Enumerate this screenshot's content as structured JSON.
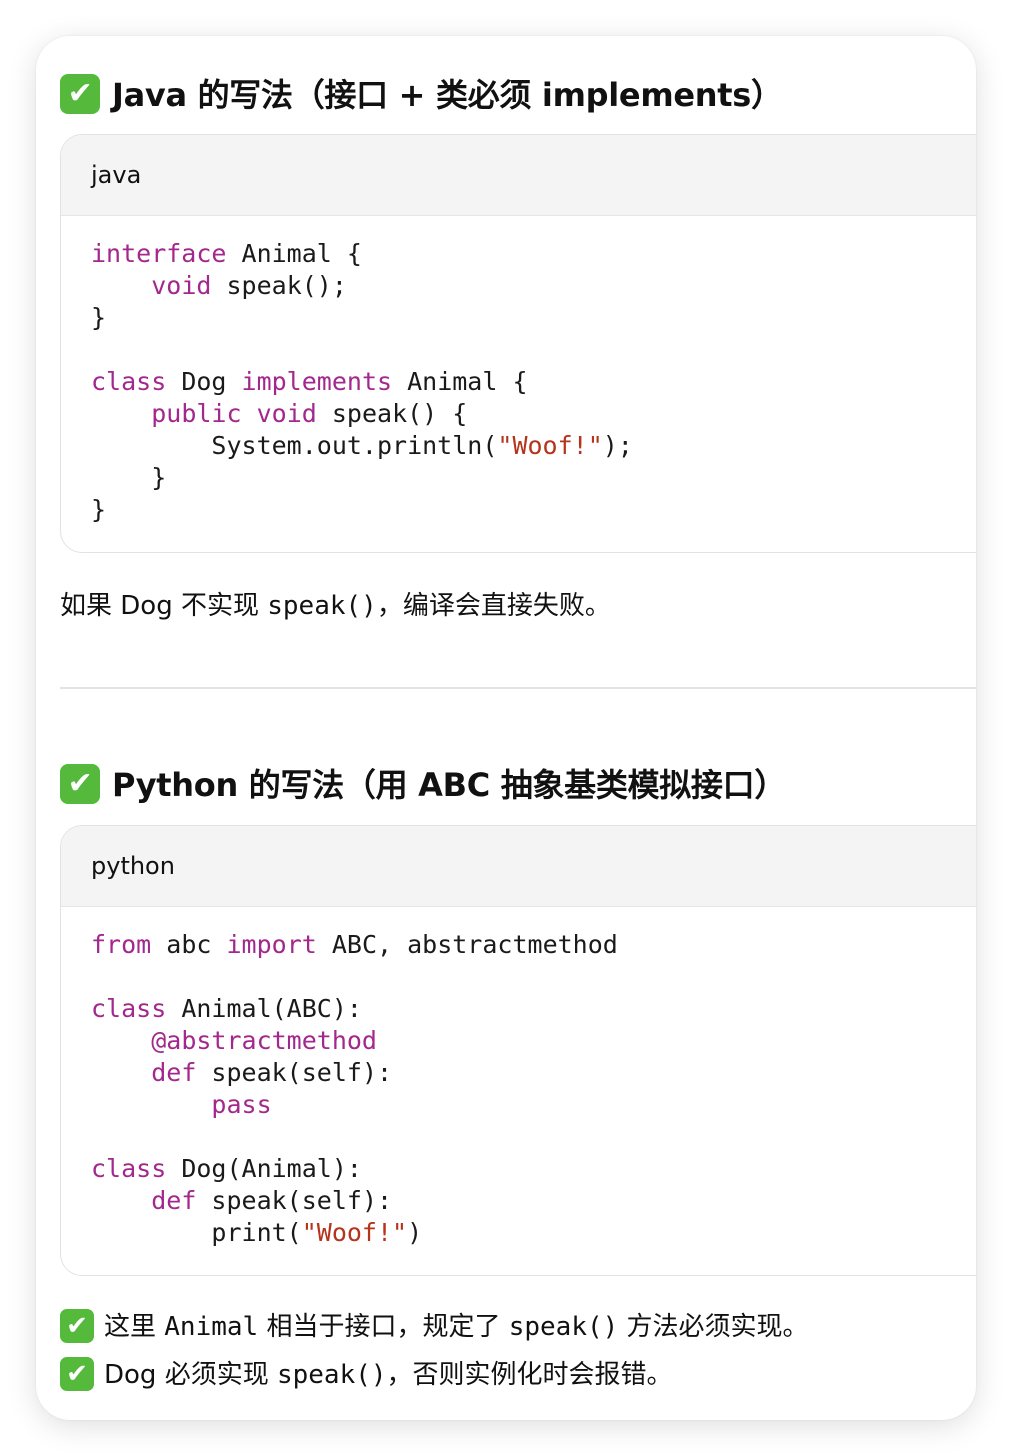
{
  "java_section": {
    "heading": "Java 的写法（接口 + 类必须 implements）",
    "code_lang": "java",
    "code_lines": [
      [
        {
          "t": "interface",
          "k": "kw"
        },
        {
          "t": " Animal {"
        }
      ],
      [
        {
          "t": "    "
        },
        {
          "t": "void",
          "k": "kw"
        },
        {
          "t": " speak();"
        }
      ],
      [
        {
          "t": "}"
        }
      ],
      [],
      [
        {
          "t": "class",
          "k": "kw"
        },
        {
          "t": " Dog "
        },
        {
          "t": "implements",
          "k": "kw"
        },
        {
          "t": " Animal {"
        }
      ],
      [
        {
          "t": "    "
        },
        {
          "t": "public",
          "k": "kw"
        },
        {
          "t": " "
        },
        {
          "t": "void",
          "k": "kw"
        },
        {
          "t": " speak() {"
        }
      ],
      [
        {
          "t": "        System.out.println("
        },
        {
          "t": "\"Woof!\"",
          "k": "str"
        },
        {
          "t": ");"
        }
      ],
      [
        {
          "t": "    }"
        }
      ],
      [
        {
          "t": "}"
        }
      ]
    ],
    "note_prefix": "如果 Dog 不实现 ",
    "note_code": "speak()",
    "note_suffix": "，编译会直接失败。"
  },
  "python_section": {
    "heading": "Python 的写法（用 ABC 抽象基类模拟接口）",
    "code_lang": "python",
    "code_lines": [
      [
        {
          "t": "from",
          "k": "kw"
        },
        {
          "t": " abc "
        },
        {
          "t": "import",
          "k": "kw"
        },
        {
          "t": " ABC, abstractmethod"
        }
      ],
      [],
      [
        {
          "t": "class",
          "k": "kw"
        },
        {
          "t": " Animal(ABC):"
        }
      ],
      [
        {
          "t": "    "
        },
        {
          "t": "@abstractmethod",
          "k": "kw"
        }
      ],
      [
        {
          "t": "    "
        },
        {
          "t": "def",
          "k": "kw"
        },
        {
          "t": " speak(self):"
        }
      ],
      [
        {
          "t": "        "
        },
        {
          "t": "pass",
          "k": "kw"
        }
      ],
      [],
      [
        {
          "t": "class",
          "k": "kw"
        },
        {
          "t": " Dog(Animal):"
        }
      ],
      [
        {
          "t": "    "
        },
        {
          "t": "def",
          "k": "kw"
        },
        {
          "t": " speak(self):"
        }
      ],
      [
        {
          "t": "        print("
        },
        {
          "t": "\"Woof!\"",
          "k": "str"
        },
        {
          "t": ")"
        }
      ]
    ]
  },
  "notes": [
    {
      "check": "✔",
      "prefix": "这里 ",
      "code1": "Animal",
      "mid": " 相当于接口，规定了 ",
      "code2": "speak()",
      "suffix": " 方法必须实现。"
    },
    {
      "check": "✔",
      "prefix": "Dog 必须实现 ",
      "code1": "speak()",
      "mid": "，否则实例化时会报错。",
      "code2": "",
      "suffix": ""
    }
  ],
  "heading_check": "✔",
  "colors": {
    "keyword": "#a3288d",
    "string": "#b5341c",
    "check_bg": "#55b93b"
  },
  "icons": [
    "check-mark-icon"
  ]
}
